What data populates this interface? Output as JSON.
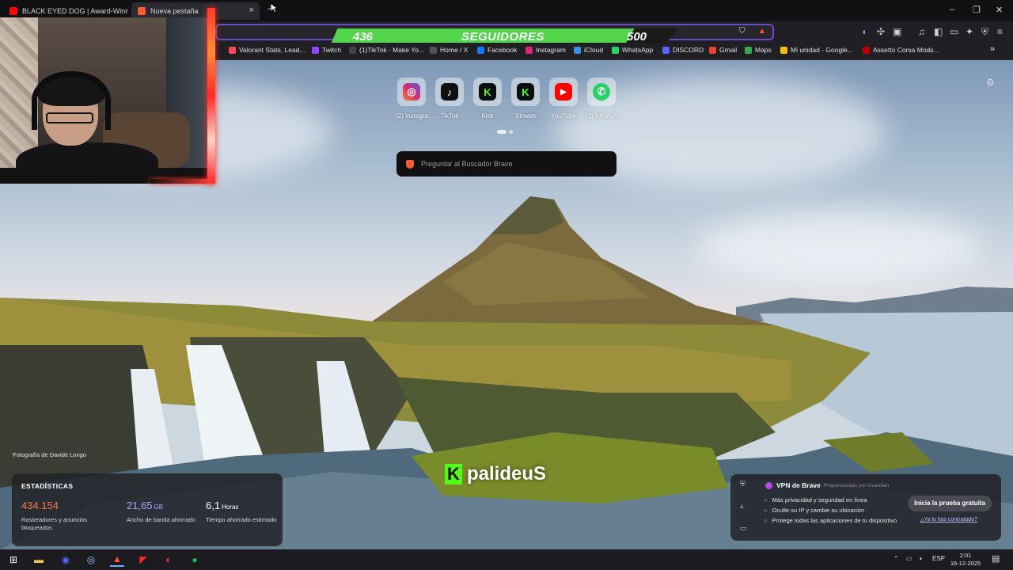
{
  "tabs": [
    {
      "title": "BLACK EYED DOG | Award-Winning S",
      "favicon_color": "#ff0000"
    },
    {
      "title": "Nueva pestaña",
      "favicon_color": "#ff5a2b"
    }
  ],
  "new_tab_symbol": "+",
  "close_symbol": "×",
  "window_controls": {
    "minimize": "–",
    "restore": "❐",
    "close": "✕"
  },
  "overlay": {
    "current": "436",
    "label": "SEGUIDORES",
    "goal": "500",
    "progress": 0.872
  },
  "bookmarks": [
    {
      "label": "Valorant Stats, Lead...",
      "color": "#ff4655"
    },
    {
      "label": "Twitch",
      "color": "#9146ff"
    },
    {
      "label": "(1)TikTok - Make Yo...",
      "color": "#111111"
    },
    {
      "label": "Home / X",
      "color": "#000000"
    },
    {
      "label": "Facebook",
      "color": "#1877f2"
    },
    {
      "label": "Instagram",
      "color": "#d62976"
    },
    {
      "label": "iCloud",
      "color": "#3a8ee6"
    },
    {
      "label": "WhatsApp",
      "color": "#25d366"
    },
    {
      "label": "DISCORD",
      "color": "#5865f2"
    },
    {
      "label": "Gmail",
      "color": "#ea4335"
    },
    {
      "label": "Maps",
      "color": "#34a853"
    },
    {
      "label": "Mi unidad - Google...",
      "color": "#fbbc04"
    },
    {
      "label": "Assetto Corsa Mods...",
      "color": "#c00000"
    }
  ],
  "bookmarks_more": "»",
  "top_sites": [
    {
      "name": "(2) Instagra...",
      "glyph": "◎",
      "color": "#d62976"
    },
    {
      "name": "TikTok",
      "glyph": "♪",
      "color": "#111111"
    },
    {
      "name": "Kick",
      "glyph": "K",
      "color": "#53fc18"
    },
    {
      "name": "Stream",
      "glyph": "K",
      "color": "#53fc18"
    },
    {
      "name": "YouTube",
      "glyph": "▶",
      "color": "#ff0000"
    },
    {
      "name": "(1) WhatsA...",
      "glyph": "✆",
      "color": "#25d366"
    }
  ],
  "search": {
    "placeholder": "Preguntar al Buscador Brave"
  },
  "photo_credit": "Fotografía de Davide Longo",
  "stats": {
    "title": "ESTADÍSTICAS",
    "items": [
      {
        "value": "434.154",
        "unit": "",
        "caption": "Rastreadores y anuncios bloqueados",
        "color": "#ff7a45"
      },
      {
        "value": "21,65",
        "unit": "GB",
        "caption": "Ancho de banda ahorrado",
        "color": "#a9a6ff"
      },
      {
        "value": "6,1",
        "unit": "Horas",
        "caption": "Tiempo ahorrado estimado",
        "color": "#ffffff"
      }
    ]
  },
  "brand": {
    "logo": "K",
    "name": "palideuS"
  },
  "vpn": {
    "title": "VPN de Brave",
    "provider": "Proporcionado por Guardian",
    "features": [
      "Más privacidad y seguridad en línea",
      "Oculte su IP y cambie su ubicación",
      "Protege todas las aplicaciones de tu dispositivo"
    ],
    "cta": "Inicia la prueba gratuita",
    "already": "¿Ya lo has contratado?"
  },
  "taskbar": {
    "lang": "ESP",
    "time": "2:01",
    "date": "16-12-2025"
  }
}
